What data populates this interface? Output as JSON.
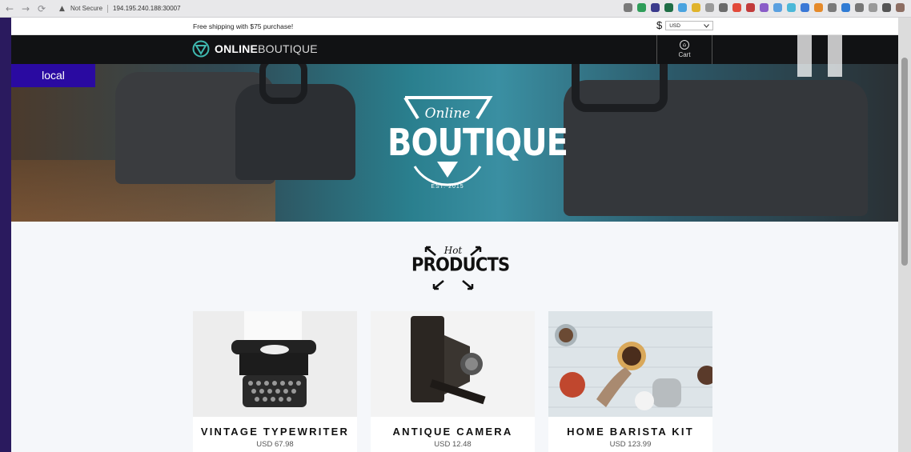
{
  "browser": {
    "security": "Not Secure",
    "url": "194.195.240.188:30007",
    "nav_back": "←",
    "nav_forward": "→",
    "nav_reload": "⟳",
    "warning_icon": "▲",
    "extensions_colors": [
      "#7a7a7a",
      "#2f9e5a",
      "#3a3a8c",
      "#1f6e46",
      "#4aa3df",
      "#e0b32b",
      "#9a9a9a",
      "#6b6b6b",
      "#e24a3a",
      "#c23b3b",
      "#8a5cc8",
      "#5aa0e0",
      "#4cb8d8",
      "#3a78d6",
      "#e58a2a",
      "#7a7a7a",
      "#2f7bd4",
      "#777",
      "#999",
      "#555",
      "#8d6e63"
    ]
  },
  "header": {
    "shipping_text": "Free shipping with $75 purchase!",
    "currency_symbol": "$",
    "currency_value": "USD",
    "logo_bold": "ONLINE",
    "logo_light": "BOUTIQUE",
    "cart_label": "Cart"
  },
  "hero": {
    "env_badge": "local",
    "logo_online": "Online",
    "logo_boutique": "BOUTIQUE",
    "logo_est": "EST. 2015"
  },
  "section": {
    "hot": "Hot",
    "products": "PRODUCTS"
  },
  "products": [
    {
      "name": "VINTAGE TYPEWRITER",
      "price": "USD 67.98",
      "image_icon": "typewriter-image"
    },
    {
      "name": "ANTIQUE CAMERA",
      "price": "USD 12.48",
      "image_icon": "camera-image"
    },
    {
      "name": "HOME BARISTA KIT",
      "price": "USD 123.99",
      "image_icon": "barista-kit-image"
    }
  ]
}
